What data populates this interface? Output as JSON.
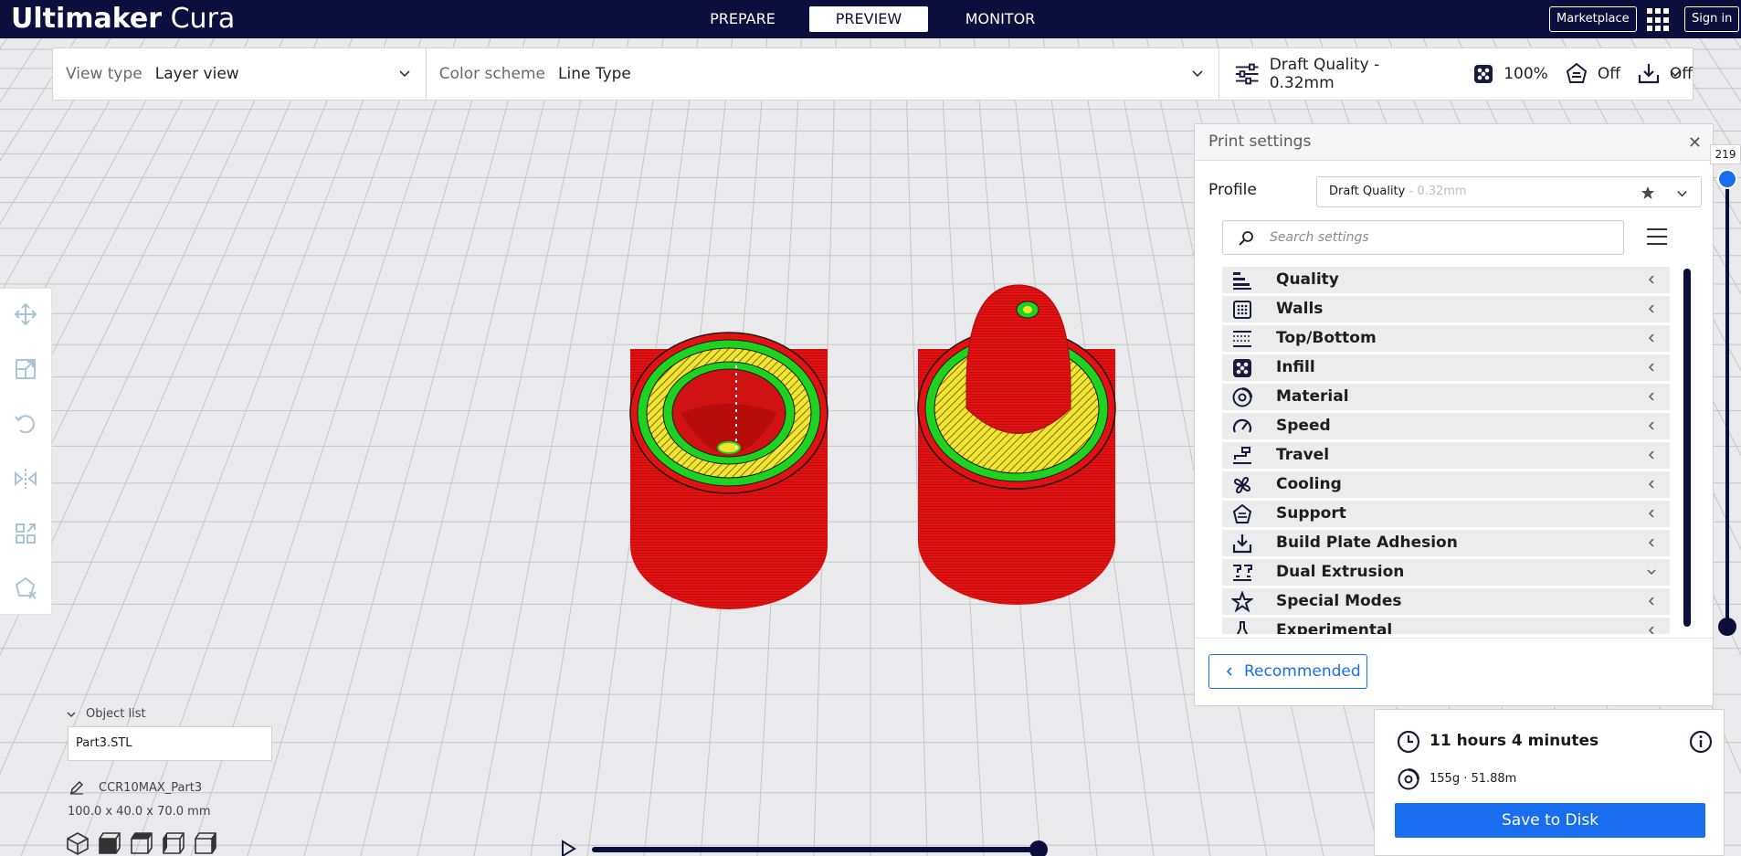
{
  "app": {
    "title_bold": "Ultimaker",
    "title_light": "Cura"
  },
  "stages": [
    {
      "label": "PREPARE",
      "active": false
    },
    {
      "label": "PREVIEW",
      "active": true
    },
    {
      "label": "MONITOR",
      "active": false
    }
  ],
  "header": {
    "marketplace": "Marketplace",
    "signin": "Sign in"
  },
  "viewbar": {
    "view_type_label": "View type",
    "view_type_value": "Layer view",
    "color_scheme_label": "Color scheme",
    "color_scheme_value": "Line Type",
    "quality": "Draft Quality - 0.32mm",
    "infill": "100%",
    "support": "Off",
    "adhesion": "Off"
  },
  "print_settings": {
    "title": "Print settings",
    "profile_label": "Profile",
    "profile_name": "Draft Quality",
    "profile_sub": " - 0.32mm",
    "search_placeholder": "Search settings",
    "categories": [
      {
        "label": "Quality",
        "icon": "quality-icon",
        "expanded": false
      },
      {
        "label": "Walls",
        "icon": "walls-icon",
        "expanded": false
      },
      {
        "label": "Top/Bottom",
        "icon": "top-bottom-icon",
        "expanded": false
      },
      {
        "label": "Infill",
        "icon": "infill-icon",
        "expanded": false
      },
      {
        "label": "Material",
        "icon": "material-icon",
        "expanded": false
      },
      {
        "label": "Speed",
        "icon": "speed-icon",
        "expanded": false
      },
      {
        "label": "Travel",
        "icon": "travel-icon",
        "expanded": false
      },
      {
        "label": "Cooling",
        "icon": "cooling-icon",
        "expanded": false
      },
      {
        "label": "Support",
        "icon": "support-icon",
        "expanded": false
      },
      {
        "label": "Build Plate Adhesion",
        "icon": "build-plate-adhesion-icon",
        "expanded": false
      },
      {
        "label": "Dual Extrusion",
        "icon": "dual-extrusion-icon",
        "expanded": true
      },
      {
        "label": "Special Modes",
        "icon": "special-modes-icon",
        "expanded": false
      },
      {
        "label": "Experimental",
        "icon": "experimental-icon",
        "expanded": false
      }
    ],
    "recommended_label": "Recommended"
  },
  "layer_slider": {
    "top_value": "219"
  },
  "estimate": {
    "time": "11 hours 4 minutes",
    "material": "155g · 51.88m",
    "save_label": "Save to Disk"
  },
  "object_list": {
    "header": "Object list",
    "items": [
      "Part3.STL"
    ],
    "job_name": "CCR10MAX_Part3",
    "dimensions": "100.0 x 40.0 x 70.0 mm"
  },
  "colors": {
    "header_bg": "#0c0e3e",
    "accent": "#196ef0",
    "wall_red": "#e51010",
    "skin_yellow": "#f5e430",
    "inner_wall_green": "#1ed320"
  }
}
